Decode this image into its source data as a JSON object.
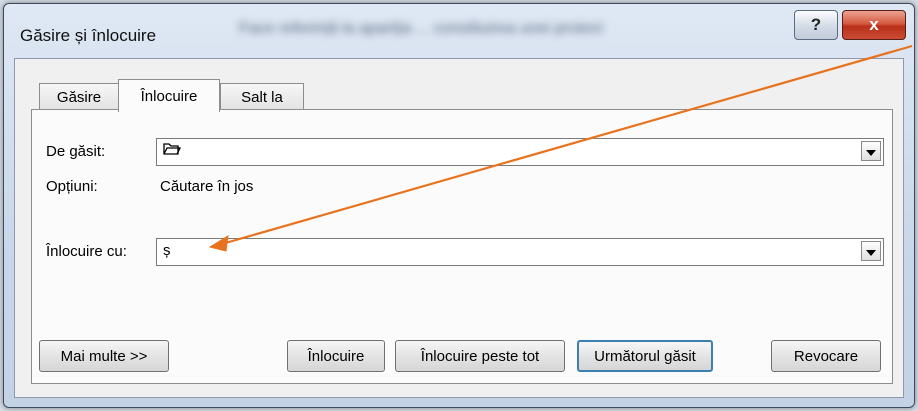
{
  "window": {
    "title": "Găsire și înlocuire",
    "background_text": "Face referință la apariția ... constituirea unei proiect",
    "help_label": "?",
    "close_label": "x"
  },
  "tabs": [
    {
      "label": "Găsire",
      "active": false
    },
    {
      "label": "Înlocuire",
      "active": true
    },
    {
      "label": "Salt la",
      "active": false
    }
  ],
  "find": {
    "label": "De găsit:",
    "icon": "folder-icon"
  },
  "options": {
    "label": "Opțiuni:",
    "value": "Căutare în jos"
  },
  "replace": {
    "label": "Înlocuire cu:",
    "value": "ș"
  },
  "buttons": {
    "more": "Mai multe >>",
    "replace": "Înlocuire",
    "replace_all": "Înlocuire peste tot",
    "find_next": "Următorul găsit",
    "cancel": "Revocare"
  },
  "colors": {
    "annotation_arrow": "#e8731f",
    "close_button": "#c94d33",
    "default_button_border": "#3c7fb1"
  }
}
